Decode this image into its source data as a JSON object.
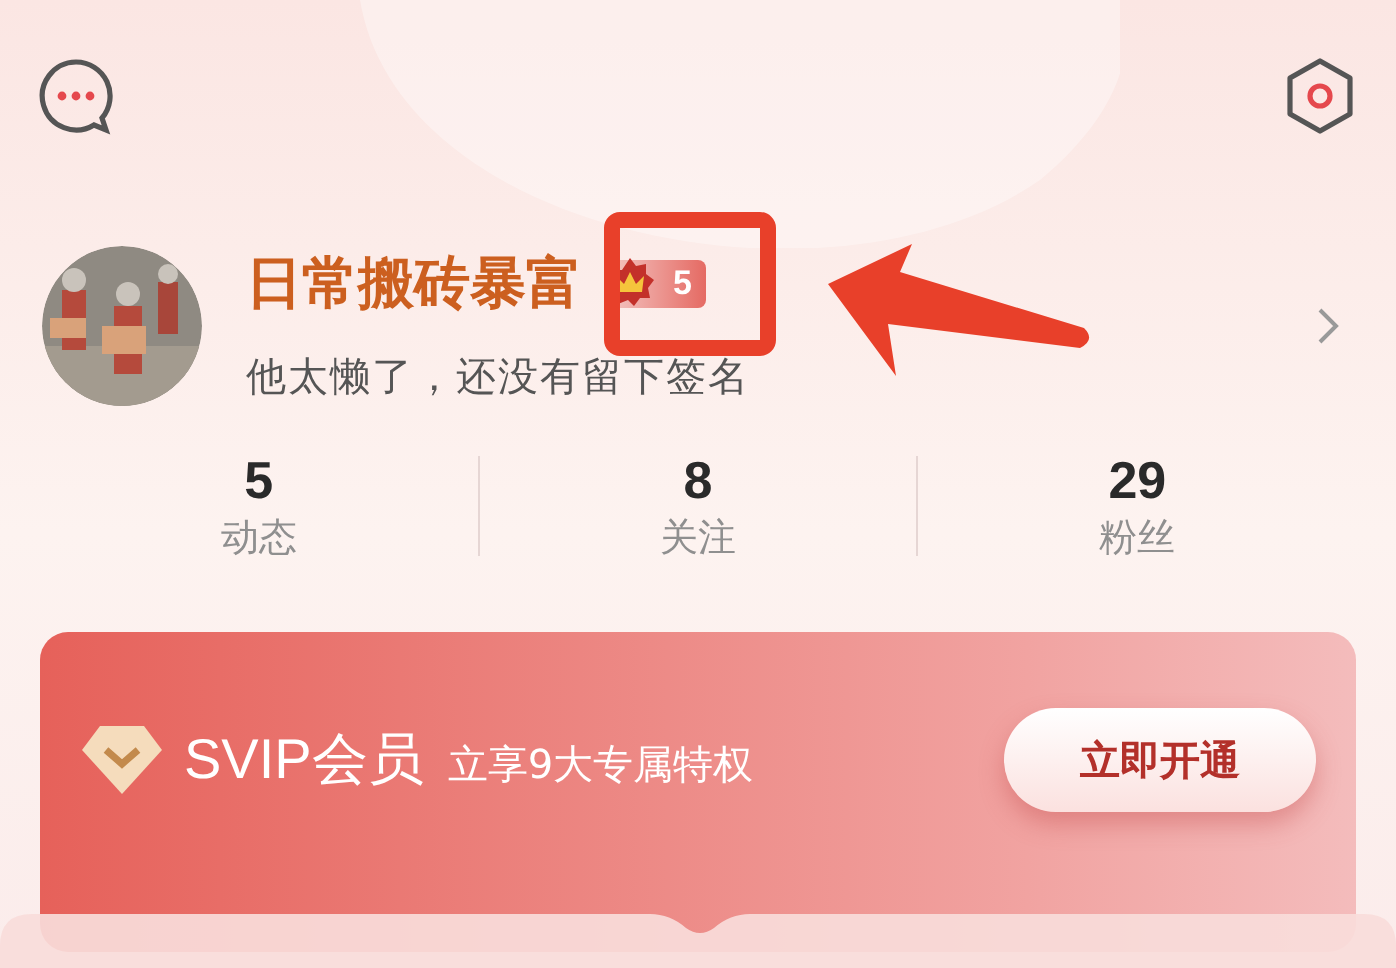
{
  "profile": {
    "name": "日常搬砖暴富",
    "level": "5",
    "signature": "他太懒了，还没有留下签名"
  },
  "stats": [
    {
      "value": "5",
      "label": "动态"
    },
    {
      "value": "8",
      "label": "关注"
    },
    {
      "value": "29",
      "label": "粉丝"
    }
  ],
  "vip_card": {
    "title": "SVIP会员",
    "subtitle": "立享9大专属特权",
    "button": "立即开通"
  }
}
